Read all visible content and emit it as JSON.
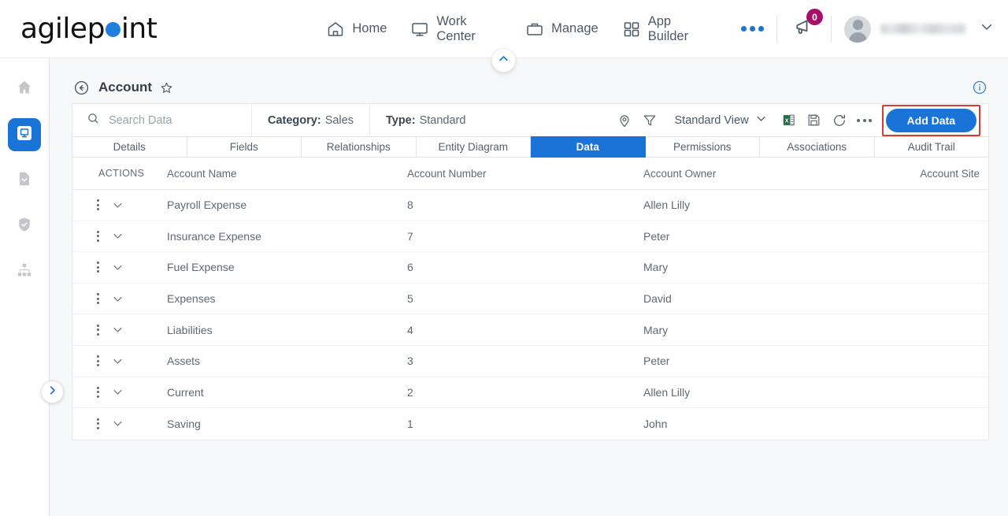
{
  "brand": {
    "name_part1": "agilep",
    "name_part2": "int",
    "dot_color": "#1f7fe0"
  },
  "header": {
    "nav": [
      {
        "label": "Home",
        "icon": "home-icon"
      },
      {
        "label": "Work Center",
        "icon": "monitor-icon"
      },
      {
        "label": "Manage",
        "icon": "briefcase-icon"
      },
      {
        "label": "App Builder",
        "icon": "grid-icon"
      }
    ],
    "more_label": "more-options",
    "notifications": {
      "icon": "megaphone-icon",
      "count": "0",
      "badge_color": "#a6106b"
    },
    "user": {
      "name": "",
      "avatar_icon": "user-avatar-icon",
      "chevron": "chevron-down-icon"
    }
  },
  "sidebar": {
    "items": [
      {
        "icon": "home-icon",
        "active": false
      },
      {
        "icon": "monitor-app-icon",
        "active": true
      },
      {
        "icon": "document-chevron-icon",
        "active": false
      },
      {
        "icon": "shield-check-icon",
        "active": false
      },
      {
        "icon": "hierarchy-icon",
        "active": false
      }
    ],
    "expander_icon": "chevron-right-icon"
  },
  "page": {
    "collapse_icon": "chevron-up-icon",
    "back_icon": "back-arrow-icon",
    "title": "Account",
    "favorite_icon": "star-icon",
    "info_icon": "info-icon"
  },
  "toolbar": {
    "search": {
      "placeholder": "Search Data",
      "value": "",
      "icon": "search-icon"
    },
    "category": {
      "label": "Category:",
      "value": "Sales"
    },
    "type": {
      "label": "Type:",
      "value": "Standard"
    },
    "icons": [
      {
        "name": "location-pin-icon"
      },
      {
        "name": "filter-icon"
      }
    ],
    "view_selector": {
      "label": "Standard View",
      "chevron": "chevron-down-icon"
    },
    "excel_icon": "excel-export-icon",
    "save_icon": "save-disk-icon",
    "refresh_icon": "refresh-icon",
    "more_icon": "more-options-icon",
    "add_button": {
      "label": "Add Data",
      "color": "#1a73d6",
      "highlight_color": "#d93b35"
    }
  },
  "tabs": [
    {
      "label": "Details",
      "active": false
    },
    {
      "label": "Fields",
      "active": false
    },
    {
      "label": "Relationships",
      "active": false
    },
    {
      "label": "Entity Diagram",
      "active": false
    },
    {
      "label": "Data",
      "active": true
    },
    {
      "label": "Permissions",
      "active": false
    },
    {
      "label": "Associations",
      "active": false
    },
    {
      "label": "Audit Trail",
      "active": false
    }
  ],
  "table": {
    "columns": [
      "ACTIONS",
      "Account Name",
      "Account Number",
      "Account Owner",
      "Account Site"
    ],
    "row_icons": {
      "menu": "kebab-menu-icon",
      "expand": "chevron-down-icon"
    },
    "rows": [
      {
        "name": "Payroll Expense",
        "number": "8",
        "owner": "Allen Lilly",
        "site": ""
      },
      {
        "name": "Insurance Expense",
        "number": "7",
        "owner": "Peter",
        "site": ""
      },
      {
        "name": "Fuel Expense",
        "number": "6",
        "owner": "Mary",
        "site": ""
      },
      {
        "name": "Expenses",
        "number": "5",
        "owner": "David",
        "site": ""
      },
      {
        "name": "Liabilities",
        "number": "4",
        "owner": "Mary",
        "site": ""
      },
      {
        "name": "Assets",
        "number": "3",
        "owner": "Peter",
        "site": ""
      },
      {
        "name": "Current",
        "number": "2",
        "owner": "Allen Lilly",
        "site": ""
      },
      {
        "name": "Saving",
        "number": "1",
        "owner": "John",
        "site": ""
      }
    ]
  }
}
